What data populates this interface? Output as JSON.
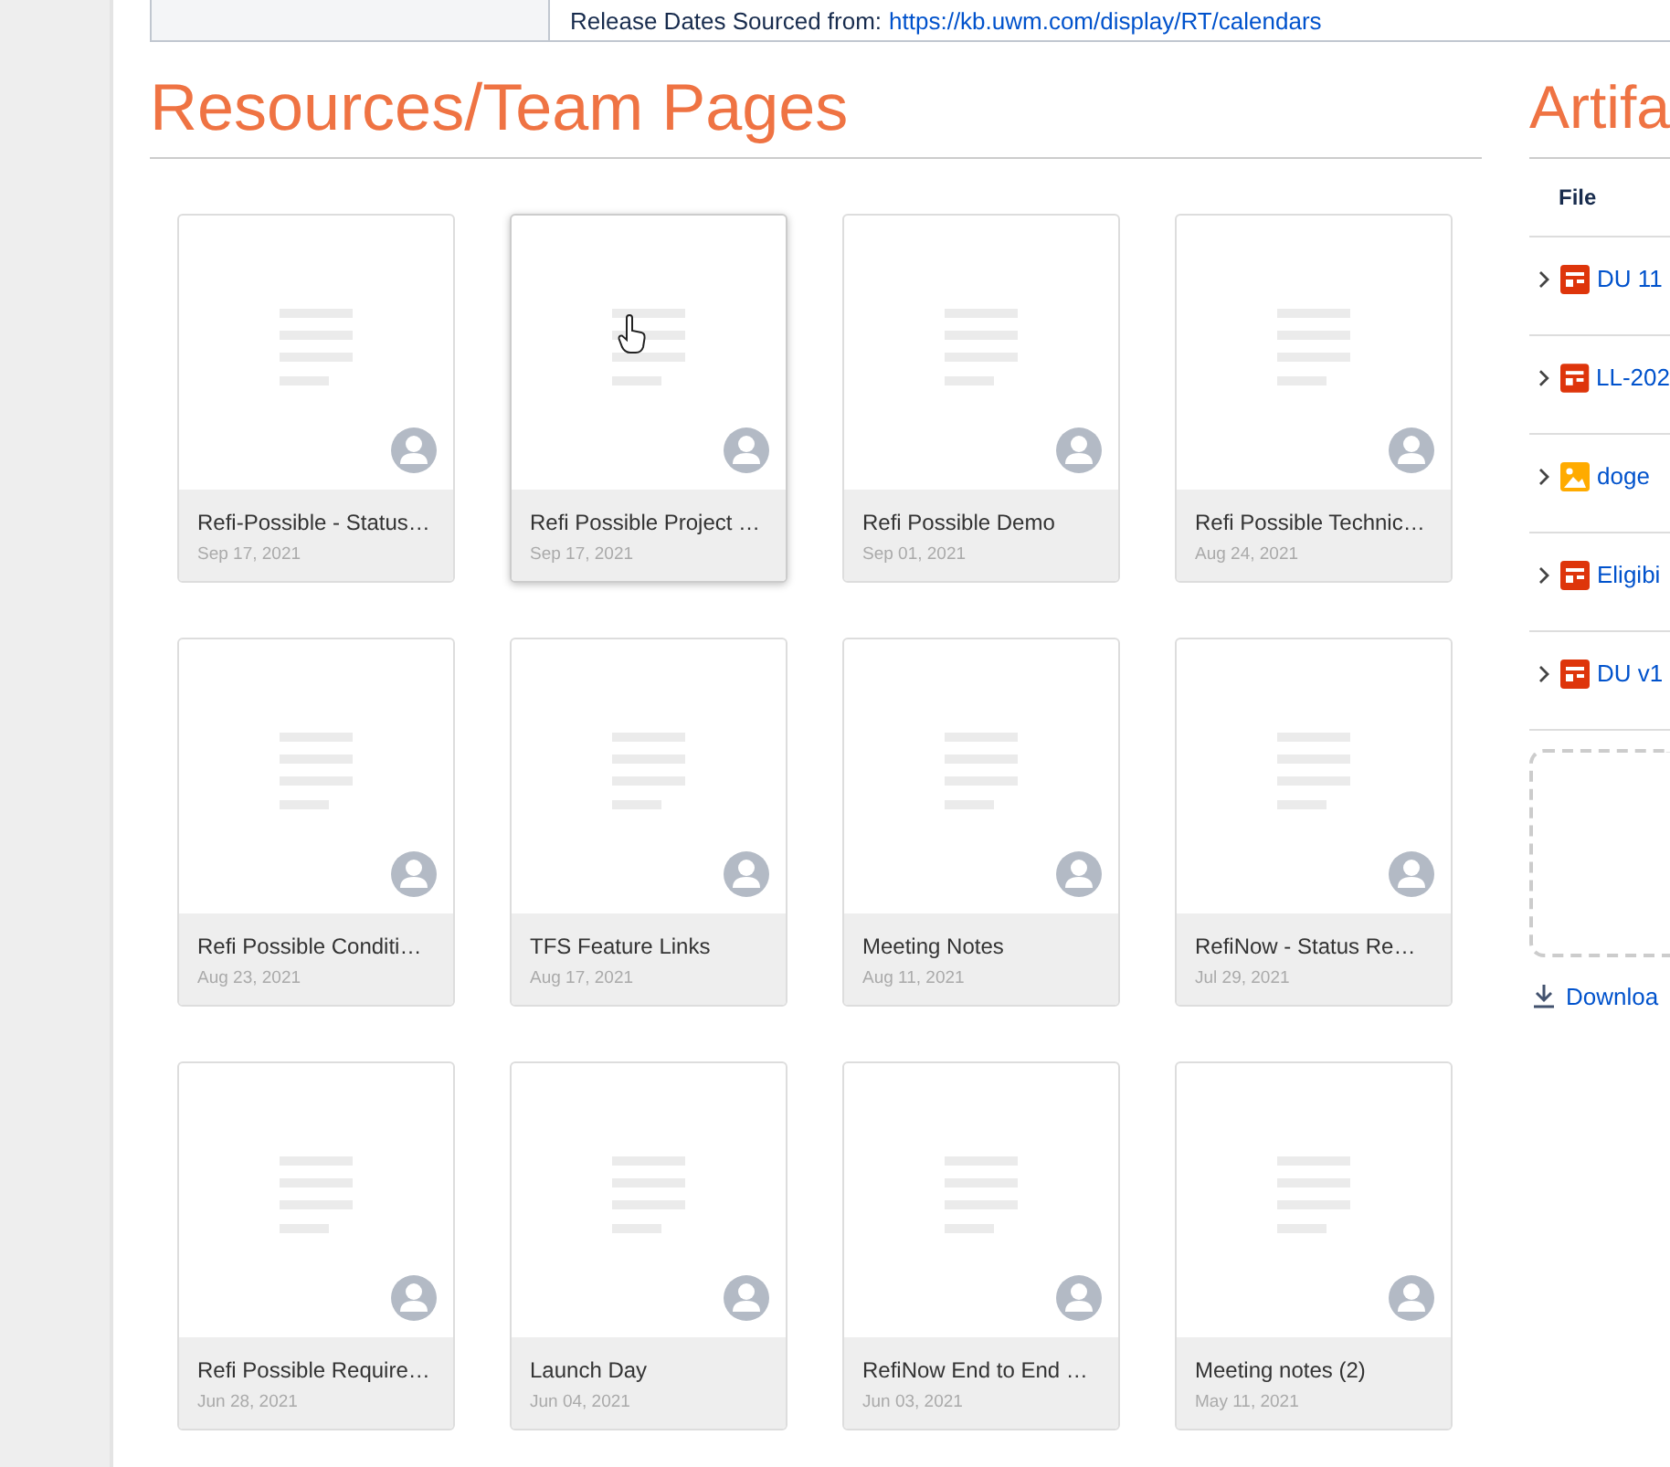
{
  "release_note": {
    "label": "Release Dates Sourced from:",
    "link": "https://kb.uwm.com/display/RT/calendars"
  },
  "resources": {
    "heading": "Resources/Team Pages",
    "cards": [
      {
        "title": "Refi-Possible - Status…",
        "date": "Sep 17, 2021",
        "hovered": false
      },
      {
        "title": "Refi Possible Project …",
        "date": "Sep 17, 2021",
        "hovered": true
      },
      {
        "title": "Refi Possible Demo",
        "date": "Sep 01, 2021",
        "hovered": false
      },
      {
        "title": "Refi Possible Technic…",
        "date": "Aug 24, 2021",
        "hovered": false
      },
      {
        "title": "Refi Possible Conditi…",
        "date": "Aug 23, 2021",
        "hovered": false
      },
      {
        "title": "TFS Feature Links",
        "date": "Aug 17, 2021",
        "hovered": false
      },
      {
        "title": "Meeting Notes",
        "date": "Aug 11, 2021",
        "hovered": false
      },
      {
        "title": "RefiNow - Status Re…",
        "date": "Jul 29, 2021",
        "hovered": false
      },
      {
        "title": "Refi Possible Require…",
        "date": "Jun 28, 2021",
        "hovered": false
      },
      {
        "title": "Launch Day",
        "date": "Jun 04, 2021",
        "hovered": false
      },
      {
        "title": "RefiNow End to End …",
        "date": "Jun 03, 2021",
        "hovered": false
      },
      {
        "title": "Meeting notes (2)",
        "date": "May 11, 2021",
        "hovered": false
      }
    ]
  },
  "artifacts": {
    "heading": "Artifa",
    "column": "File",
    "files": [
      {
        "kind": "document",
        "name": "DU 11"
      },
      {
        "kind": "document",
        "name": "LL-202"
      },
      {
        "kind": "image",
        "name": "doge"
      },
      {
        "kind": "document",
        "name": "Eligibi"
      },
      {
        "kind": "document",
        "name": "DU v1"
      }
    ],
    "download": "Downloa"
  }
}
